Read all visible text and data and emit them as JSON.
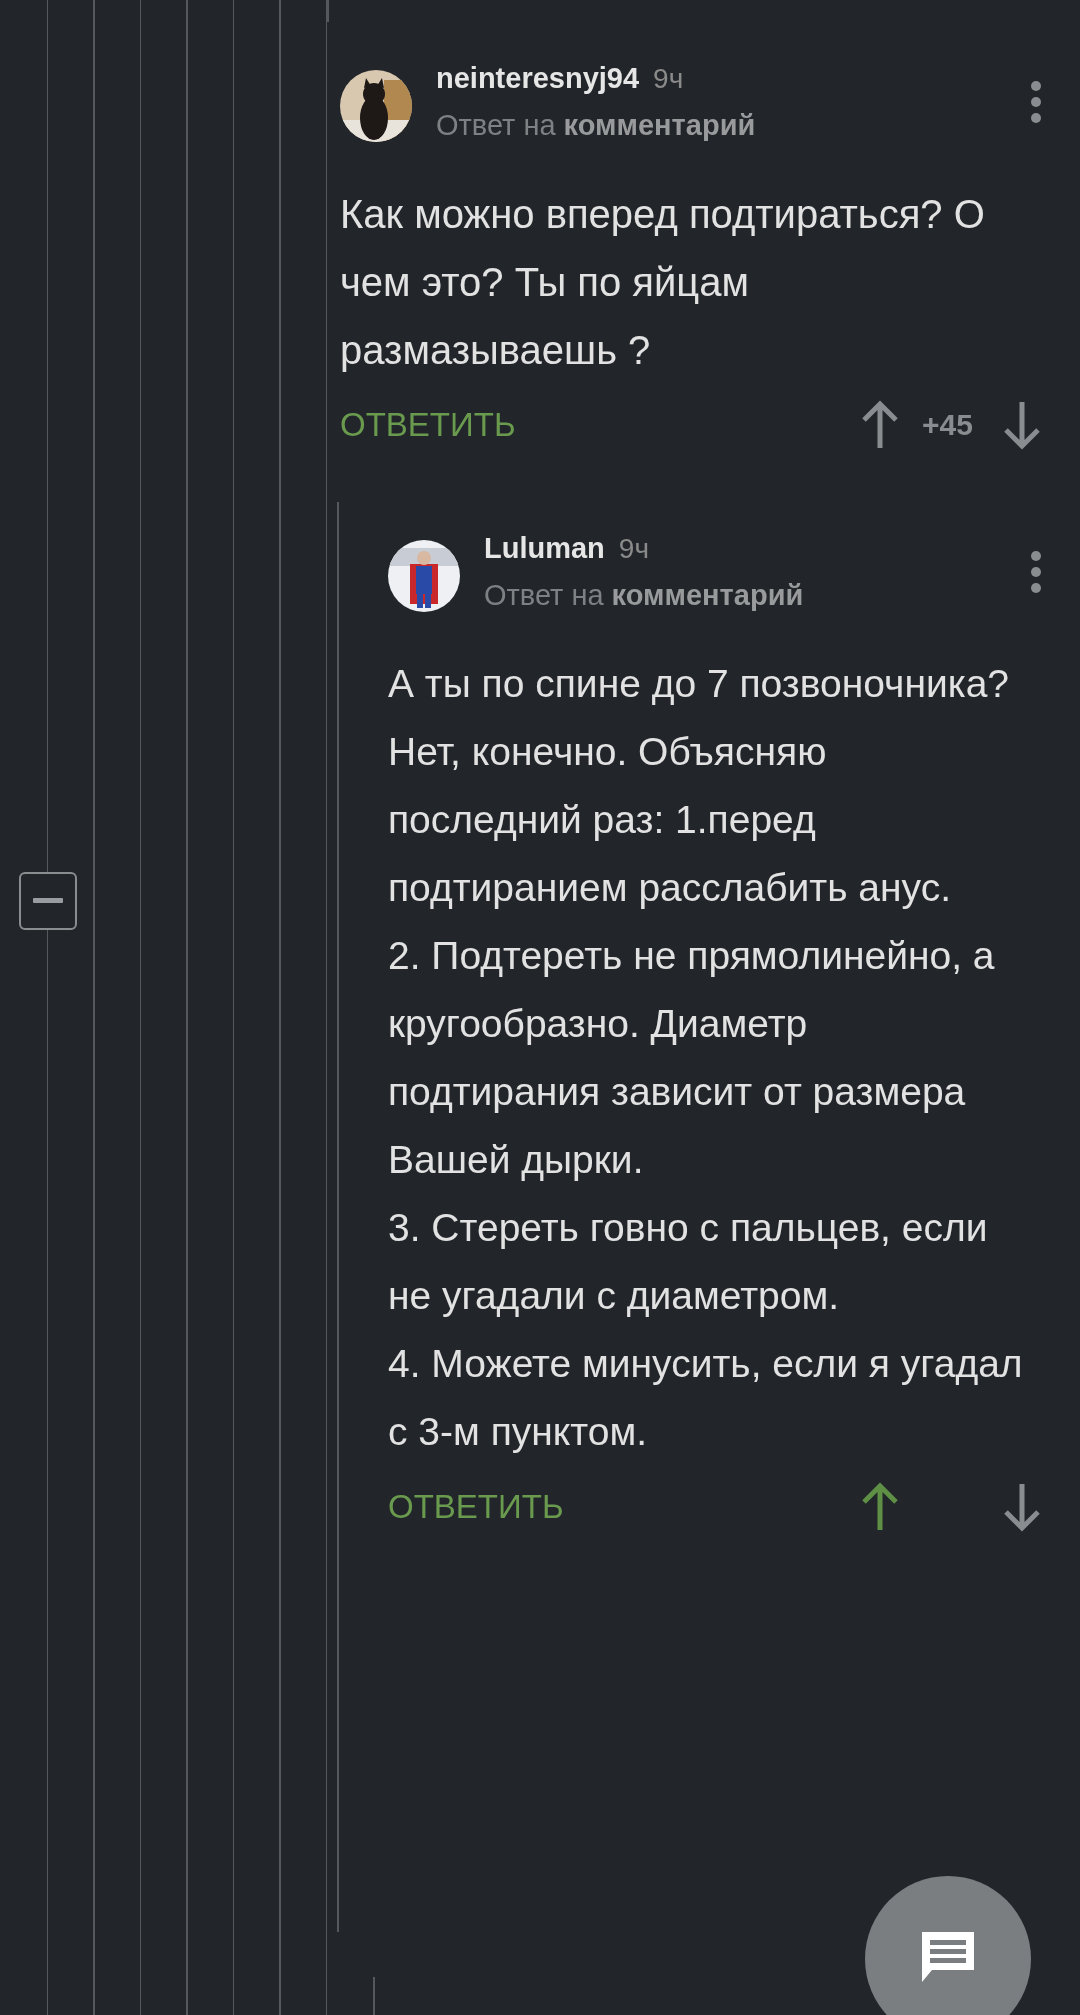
{
  "comments": [
    {
      "author": "neinteresnyj94",
      "time": "9ч",
      "reply_prefix": "Ответ на",
      "reply_target": "комментарий",
      "text": "Как можно вперед подтираться? О чем это? Ты по яйцам размазываешь ?",
      "reply_label": "ОТВЕТИТЬ",
      "score": "+45",
      "upvoted": false
    },
    {
      "author": "Luluman",
      "time": "9ч",
      "reply_prefix": "Ответ на",
      "reply_target": "комментарий",
      "text": "А ты по спине до 7 позвоночника? Нет, конечно. Объясняю последний раз: 1.перед подтиранием расслабить анус.\n2. Подтереть не прямолинейно, а кругообразно. Диаметр подтирания зависит от размера Вашей дырки.\n3. Стереть говно с пальцев, если не угадали с диаметром.\n4. Можете минусить, если я угадал с 3-м пунктом.",
      "reply_label": "ОТВЕТИТЬ",
      "upvoted": true
    }
  ]
}
